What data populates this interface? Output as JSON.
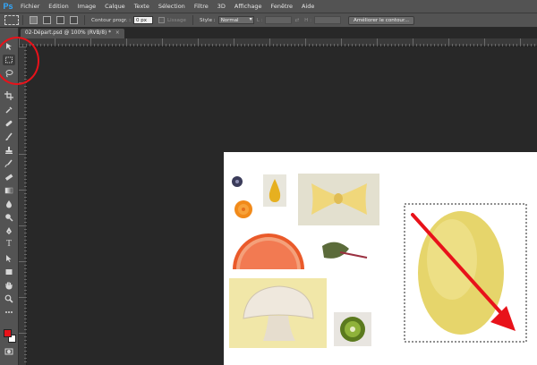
{
  "app": {
    "logo": "Ps"
  },
  "menu": [
    "Fichier",
    "Edition",
    "Image",
    "Calque",
    "Texte",
    "Sélection",
    "Filtre",
    "3D",
    "Affichage",
    "Fenêtre",
    "Aide"
  ],
  "options": {
    "feather_label": "Contour progr. :",
    "feather_value": "0 px",
    "antialias_label": "Lissage",
    "style_label": "Style :",
    "style_value": "Normal",
    "width_label": "L :",
    "height_label": "H :",
    "refine_button": "Améliorer le contour..."
  },
  "document": {
    "tab_title": "02-Départ.psd @ 100% (RVB/8)",
    "tab_modified": "*",
    "close_glyph": "×"
  },
  "tools": [
    {
      "name": "move-tool-icon"
    },
    {
      "name": "rectangular-marquee-tool-icon"
    },
    {
      "name": "lasso-tool-icon"
    },
    {
      "name": "crop-tool-icon"
    },
    {
      "name": "eyedropper-tool-icon"
    },
    {
      "name": "healing-brush-tool-icon"
    },
    {
      "name": "brush-tool-icon"
    },
    {
      "name": "clone-stamp-tool-icon"
    },
    {
      "name": "history-brush-tool-icon"
    },
    {
      "name": "eraser-tool-icon"
    },
    {
      "name": "gradient-tool-icon"
    },
    {
      "name": "blur-tool-icon"
    },
    {
      "name": "dodge-tool-icon"
    },
    {
      "name": "pen-tool-icon"
    },
    {
      "name": "type-tool-icon",
      "glyph": "T"
    },
    {
      "name": "path-selection-tool-icon"
    },
    {
      "name": "rectangle-tool-icon"
    },
    {
      "name": "hand-tool-icon"
    },
    {
      "name": "zoom-tool-icon"
    }
  ],
  "colors": {
    "foreground": "#e8121a",
    "background": "#ffffff",
    "annotation": "#e8121a",
    "accent": "#31a8ff"
  }
}
